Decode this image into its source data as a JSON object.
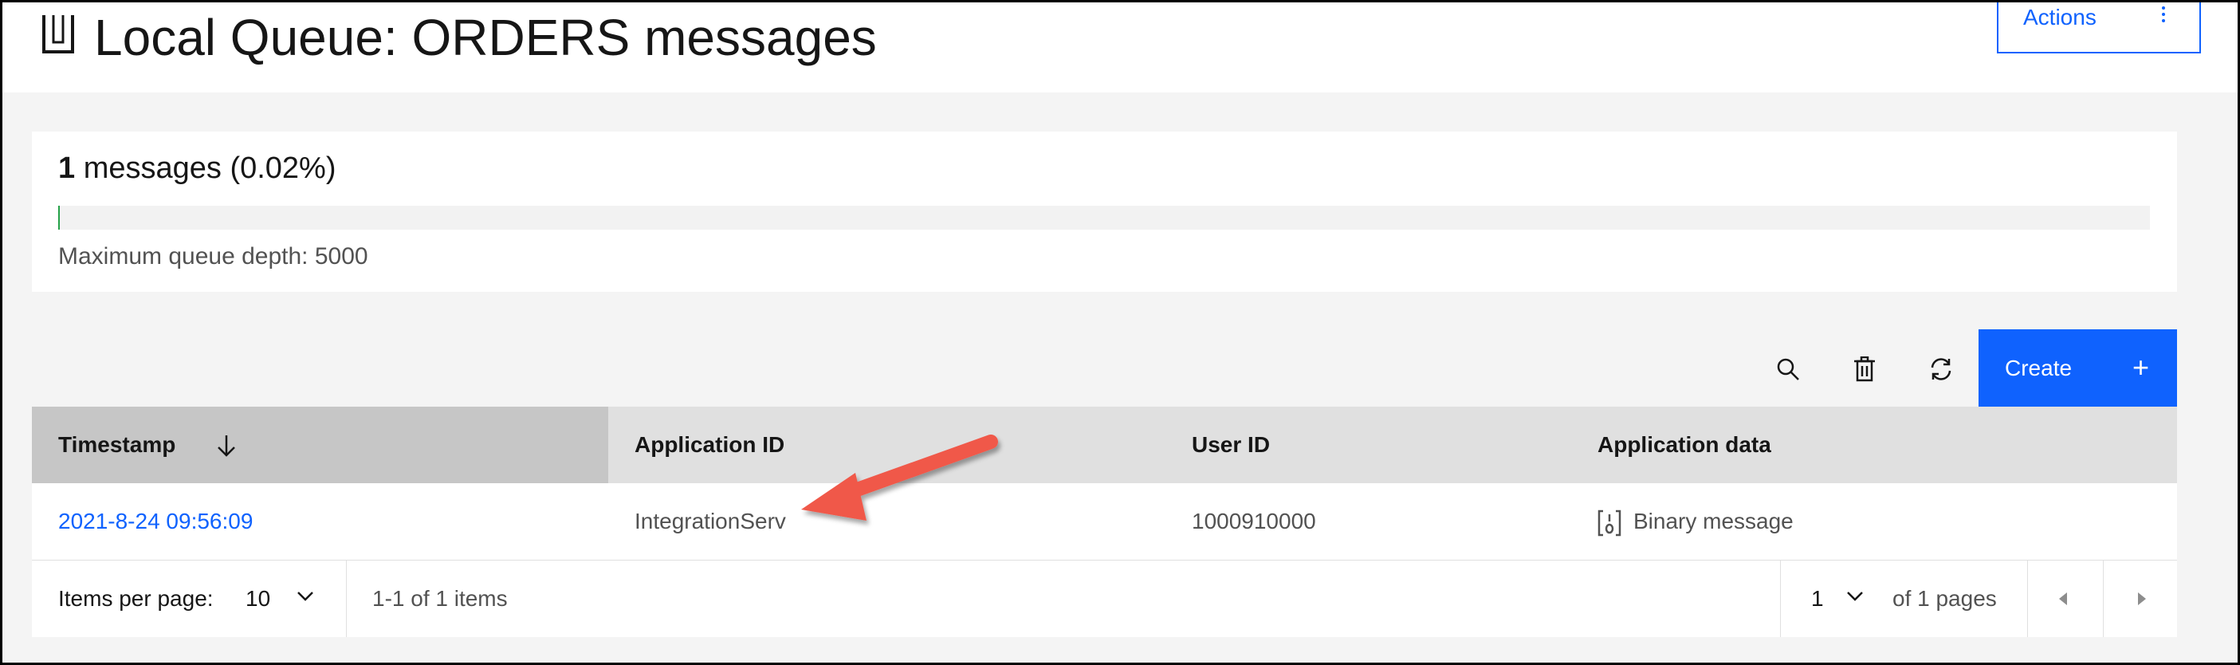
{
  "header": {
    "title": "Local Queue: ORDERS messages",
    "actions_label": "Actions"
  },
  "depth": {
    "count": "1",
    "count_suffix": " messages (0.02%)",
    "fill_percent": 0.02,
    "max_depth_label": "Maximum queue depth: 5000"
  },
  "toolbar": {
    "search_icon": "search-icon",
    "delete_icon": "trash-icon",
    "refresh_icon": "refresh-icon",
    "create_label": "Create",
    "create_icon": "+"
  },
  "table": {
    "columns": [
      "Timestamp",
      "Application ID",
      "User ID",
      "Application data"
    ],
    "sort": {
      "column": "Timestamp",
      "direction": "descending"
    },
    "rows": [
      {
        "timestamp": "2021-8-24 09:56:09",
        "application_id": "IntegrationServ",
        "user_id": "1000910000",
        "application_data": "Binary message"
      }
    ]
  },
  "pagination": {
    "items_per_page_label": "Items per page:",
    "items_per_page_value": "10",
    "range_label": "1-1 of 1 items",
    "page_value": "1",
    "pages_label": "of 1 pages"
  },
  "colors": {
    "accent": "#0f62fe",
    "annotation_arrow": "#f0584a",
    "depth_fill": "#24a148"
  }
}
